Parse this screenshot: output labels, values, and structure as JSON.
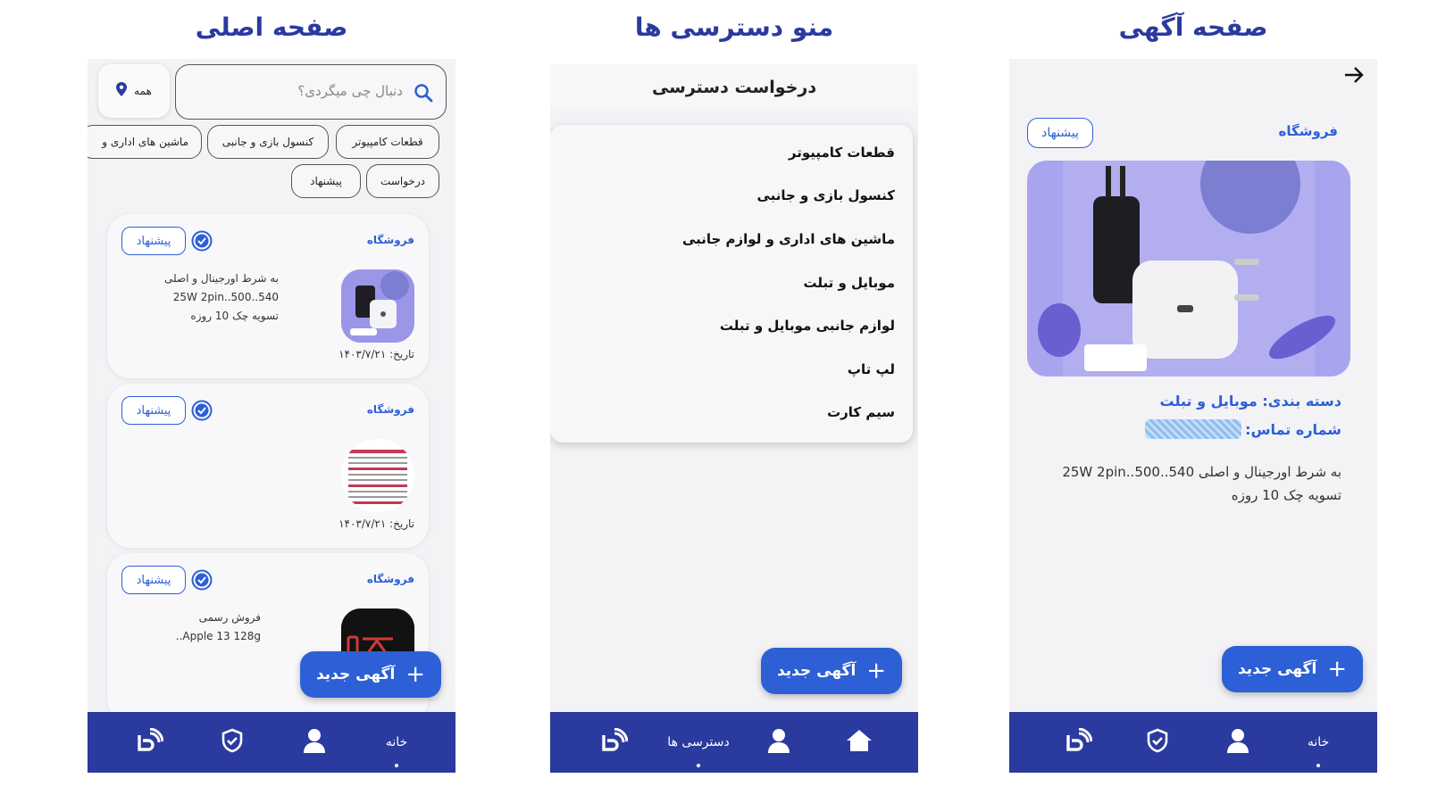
{
  "headings": {
    "home": "صفحه اصلی",
    "menu": "منو دسترسی ها",
    "ad": "صفحه آگهی"
  },
  "home": {
    "search_placeholder": "دنبال چی میگردی؟",
    "location_label": "همه",
    "chips_row1": [
      "قطعات کامپیوتر",
      "کنسول بازی و جانبی",
      "ماشین های اداری و"
    ],
    "chips_row2": [
      "درخواست",
      "پیشنهاد"
    ],
    "cards": [
      {
        "shop": "فروشگاه",
        "offer": "پیشنهاد",
        "lines": [
          "به شرط اورجینال و اصلی",
          "25W 2pin..500..540",
          "تسویه چک 10 روزه"
        ],
        "date": "تاریخ: ۱۴۰۳/۷/۲۱"
      },
      {
        "shop": "فروشگاه",
        "offer": "پیشنهاد",
        "lines": [],
        "date": "تاریخ: ۱۴۰۳/۷/۲۱"
      },
      {
        "shop": "فروشگاه",
        "offer": "پیشنهاد",
        "lines": [
          "فروش رسمی",
          "Apple 13 128g.."
        ],
        "date": ""
      }
    ],
    "fab_label": "آگهی جدید",
    "nav_home": "خانه"
  },
  "menu": {
    "title": "درخواست دسترسی",
    "items": [
      "قطعات کامپیوتر",
      "کنسول بازی و جانبی",
      "ماشین های اداری و لوازم جانبی",
      "موبایل و تبلت",
      "لوازم جانبی موبایل و تبلت",
      "لپ تاپ",
      "سیم کارت"
    ],
    "fab_label": "آگهی جدید",
    "nav_access": "دسترسی ها"
  },
  "ad": {
    "shop": "فروشگاه",
    "offer": "پیشنهاد",
    "category": "دسته بندی: موبایل و تبلت",
    "phone_label": "شماره تماس:",
    "lines": [
      "به شرط اورجینال و اصلی 540..500..25W 2pin",
      "تسویه چک 10 روزه"
    ],
    "fab_label": "آگهی جدید",
    "nav_home": "خانه"
  },
  "colors": {
    "nav_bar": "#2b3a9e",
    "accent": "#2d5fd6",
    "heading": "#2b3a9e",
    "screen_bg": "#f3f3f6"
  },
  "icons": [
    "search-icon",
    "location-pin-icon",
    "verified-check-icon",
    "plus-icon",
    "home-icon",
    "user-icon",
    "shield-check-icon",
    "app-logo-icon",
    "back-arrow-icon"
  ]
}
